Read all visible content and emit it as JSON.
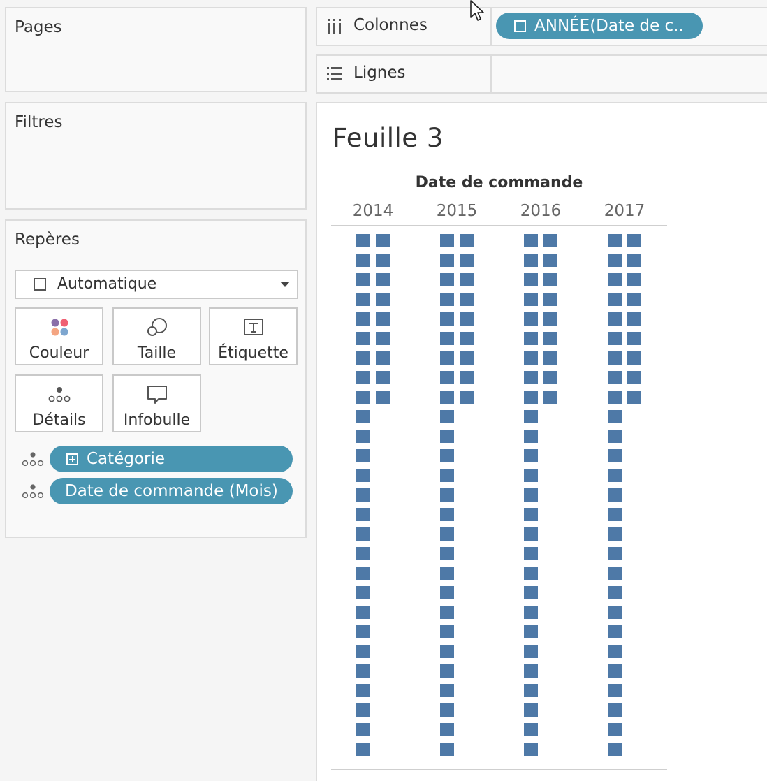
{
  "left_panel": {
    "pages_title": "Pages",
    "filters_title": "Filtres",
    "marks_title": "Repères",
    "mark_type": "Automatique",
    "buttons": {
      "color": "Couleur",
      "size": "Taille",
      "label": "Étiquette",
      "detail": "Détails",
      "tooltip": "Infobulle"
    },
    "mark_fields": [
      "Catégorie",
      "Date de commande (Mois)"
    ]
  },
  "shelves": {
    "columns_label": "Colonnes",
    "columns_pill": "ANNÉE(Date de c..",
    "rows_label": "Lignes"
  },
  "sheet": {
    "title": "Feuille 3"
  },
  "chart_data": {
    "type": "scatter",
    "title": "Feuille 3",
    "header": "Date de commande",
    "categories": [
      "2014",
      "2015",
      "2016",
      "2017"
    ],
    "marks_per_year": {
      "column_1": 27,
      "column_2": 9
    },
    "mark_color": "#4e79a7",
    "grid": false
  },
  "colors": {
    "pill": "#4996b2",
    "mark": "#4e79a7",
    "color_dots": [
      "#8a6ea8",
      "#ef5f72",
      "#f4a582",
      "#7ea6cf"
    ]
  }
}
